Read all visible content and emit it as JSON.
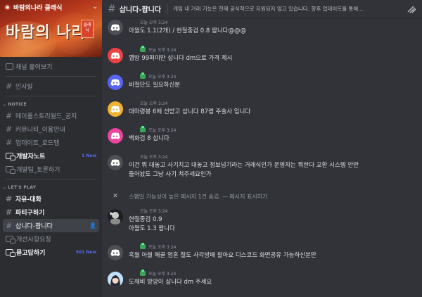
{
  "server": {
    "name": "바람의나라 클래식",
    "banner_logo": "바람의 나라",
    "banner_seal": "클래식",
    "banner_colors": [
      "#7a1f12",
      "#d9652a"
    ]
  },
  "sidebar": {
    "events_label": "채널 훑어보기",
    "top_items": [
      {
        "label": "인사말"
      }
    ],
    "categories": [
      {
        "name": "NOTICE",
        "items": [
          {
            "label": "메이플스토리월드_공지",
            "type": "text"
          },
          {
            "label": "커뮤니티_이용안내",
            "type": "text"
          },
          {
            "label": "업데이트_로드맵",
            "type": "text"
          },
          {
            "label": "개발자노트",
            "type": "forum",
            "badge": "1 New"
          },
          {
            "label": "개발팀_토론하기",
            "type": "forum"
          }
        ]
      },
      {
        "name": "LET'S PLAY",
        "items": [
          {
            "label": "자유-대화",
            "type": "text"
          },
          {
            "label": "파티구하기",
            "type": "text"
          },
          {
            "label": "삽니다-팝니다",
            "type": "text",
            "active": true
          },
          {
            "label": "개선사항요청",
            "type": "forum"
          },
          {
            "label": "묻고답하기",
            "type": "forum",
            "badge": "901 New"
          }
        ]
      }
    ]
  },
  "channel": {
    "name": "삽니다-팝니다",
    "topic": "게임 내 거래 기능은 현재 공식적으로 지원되지 않고 있습니다. 향후 업데이트를 통해..."
  },
  "messages": [
    {
      "avatar": "discord-blue",
      "color": "#4e5058",
      "time": "오늘 오후 3:24",
      "text": "아월도 1.1(2개) / 현철중검 0.8 팝니다@@@"
    },
    {
      "avatar": "discord",
      "color": "#ed4245",
      "time": "오늘 오후 3:24",
      "text": "깹방 99퍼미만 삽니다 dm으로 가격 제시",
      "role": true
    },
    {
      "avatar": "discord",
      "color": "#5865f2",
      "time": "오늘 오후 3:24",
      "text": "비철단도 필요하신분",
      "role": true
    },
    {
      "avatar": "discord",
      "color": "#f0b232",
      "time": "오늘 오후 3:24",
      "text": "대마령봉 6에 선받고 삽니다 87렙 주술사 입니다"
    },
    {
      "avatar": "discord",
      "color": "#eb459f",
      "time": "오늘 오후 3:24",
      "text": "백화검 8 삽니다",
      "role": true
    },
    {
      "avatar": "discord",
      "color": "#4e5058",
      "time": "오늘 오후 3:24",
      "text": "이건 뭐 대놓고 사기치고 대놓고 정보넘기라는 거래식인가 운영자는 뭐한다 교환 시스템 안만",
      "text2": "들어놨도 그냥 사기 쳐주세요인가"
    },
    {
      "avatar": "photo",
      "color": "#2b2b2b",
      "time": "오늘 오후 3:24",
      "text": "현철중검 0.9",
      "text2": "아월도 1.3 팝니다"
    },
    {
      "avatar": "discord",
      "color": "#4e5058",
      "time": "오늘 오후 3:24",
      "text": "흑월 아월 해골 염혼 철도 사각방패 팔아요 디스코드 화면공유 가능하신분만",
      "role": true
    },
    {
      "avatar": "girl",
      "color": "#7ab8e8",
      "time": "오늘 오후 3:24",
      "text": "도깨비 방망이 삽니다 dm 주세요",
      "role": true
    }
  ],
  "spam_notice": {
    "text": "스팸일 가능성이 높은 메시지 1건 숨김. —",
    "link": "메시지 표시하기"
  }
}
